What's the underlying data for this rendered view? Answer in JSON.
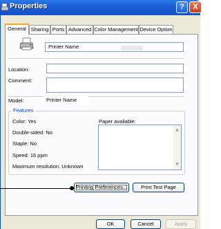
{
  "window": {
    "title": "Properties",
    "help_label": "?",
    "close_label": "X"
  },
  "tabs": [
    {
      "label": "General",
      "active": true
    },
    {
      "label": "Sharing",
      "active": false
    },
    {
      "label": "Ports",
      "active": false
    },
    {
      "label": "Advanced",
      "active": false
    },
    {
      "label": "Color Management",
      "active": false
    },
    {
      "label": "Device Option",
      "active": false
    }
  ],
  "general": {
    "printer_name": "Printer Name",
    "location_label": "Location:",
    "location_value": "",
    "comment_label": "Comment:",
    "comment_value": "",
    "model_label": "Model:",
    "model_value": "Printer Name"
  },
  "features": {
    "title": "Features",
    "color": "Color: Yes",
    "double_sided": "Double-sided: No",
    "staple": "Staple: No",
    "speed": "Speed: 16 ppm",
    "max_resolution": "Maximum resolution: Unknown",
    "paper_available_label": "Paper available:"
  },
  "buttons": {
    "printing_preferences": "Printing Preferences...",
    "print_test_page": "Print Test Page",
    "ok": "OK",
    "cancel": "Cancel",
    "apply": "Apply"
  },
  "icons": {
    "app": "printer-properties-icon",
    "printer": "printer-icon"
  },
  "colors": {
    "titlebar": "#1d5fd6",
    "dialog_bg": "#ece9d8",
    "active_tab_accent": "#f5a623",
    "group_title": "#0046d5"
  }
}
